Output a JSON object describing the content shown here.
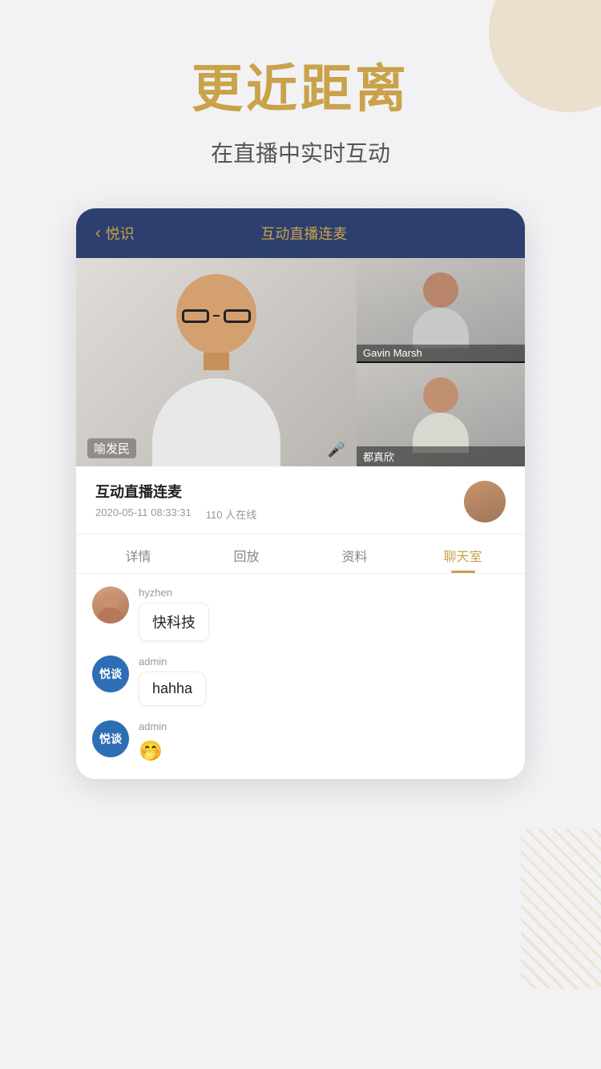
{
  "page": {
    "bg_color": "#f2f2f5"
  },
  "hero": {
    "main_title": "更近距离",
    "sub_title": "在直播中实时互动"
  },
  "card": {
    "header": {
      "back_label": "悦识",
      "title": "互动直播连麦"
    },
    "video": {
      "main_person": "喻发民",
      "side_persons": [
        {
          "name": "Gavin Marsh"
        },
        {
          "name": "都真欣"
        }
      ]
    },
    "info": {
      "title": "互动直播连麦",
      "date": "2020-05-11 08:33:31",
      "online": "110 人在线"
    },
    "tabs": [
      {
        "label": "详情",
        "active": false
      },
      {
        "label": "回放",
        "active": false
      },
      {
        "label": "资料",
        "active": false
      },
      {
        "label": "聊天室",
        "active": true
      }
    ],
    "chat": [
      {
        "avatar_type": "photo",
        "username": "hyzhen",
        "message": "快科技",
        "is_emoji": false
      },
      {
        "avatar_type": "brand",
        "brand_text": "悦谈",
        "username": "admin",
        "message": "hahha",
        "is_emoji": false
      },
      {
        "avatar_type": "brand",
        "brand_text": "悦谈",
        "username": "admin",
        "message": "🤭",
        "is_emoji": true
      }
    ]
  }
}
